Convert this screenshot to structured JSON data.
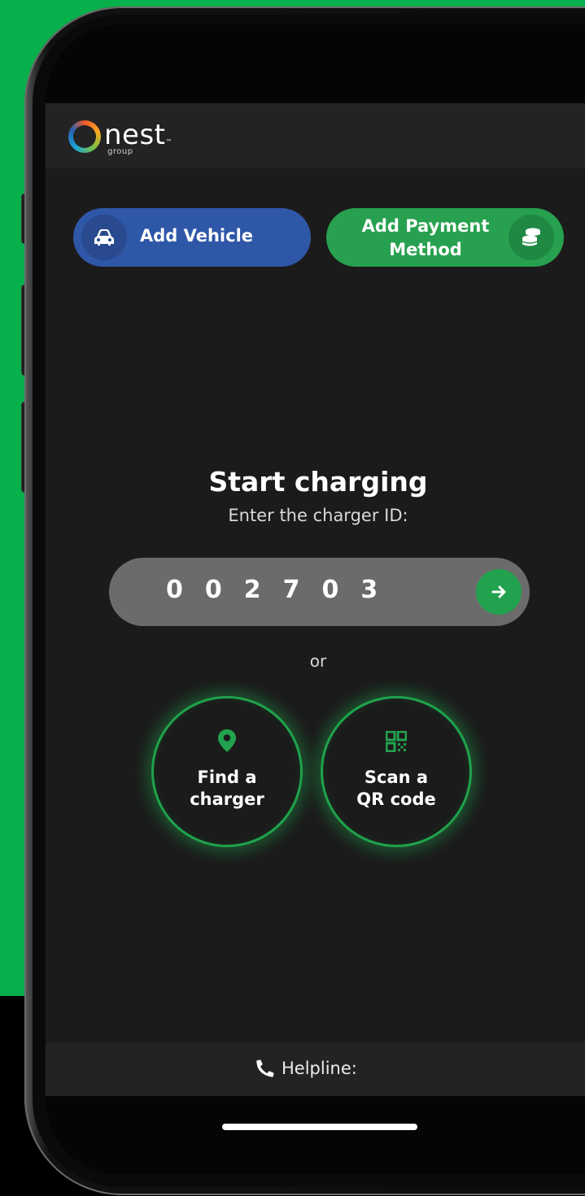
{
  "brand": {
    "name": "nest",
    "sub": "group",
    "tm": "™"
  },
  "actions": {
    "add_vehicle": "Add Vehicle",
    "add_payment": "Add Payment Method"
  },
  "charging": {
    "title": "Start charging",
    "subtitle": "Enter the charger ID:",
    "charger_id": "002703",
    "or": "or"
  },
  "options": {
    "find": "Find a charger",
    "scan": "Scan a QR code"
  },
  "footer": {
    "helpline": "Helpline:"
  },
  "colors": {
    "background_green": "#08b04b",
    "vehicle_blue": "#2f57a8",
    "payment_green": "#27a14f",
    "accent_green": "#1fa24c"
  },
  "icons": {
    "vehicle": "car-icon",
    "payment": "coins-icon",
    "submit": "arrow-right-icon",
    "find": "map-pin-icon",
    "scan": "qr-code-icon",
    "helpline": "phone-icon"
  }
}
